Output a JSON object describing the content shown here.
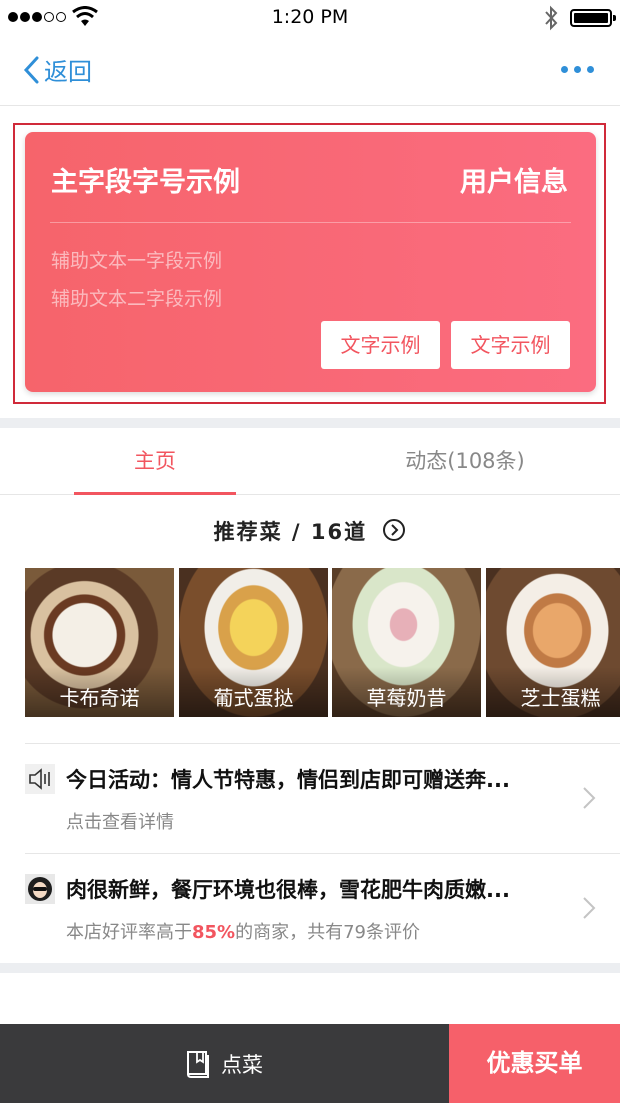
{
  "status_bar": {
    "time": "1:20 PM",
    "icons": [
      "signal-icon",
      "wifi-icon",
      "bluetooth-icon",
      "battery-icon"
    ]
  },
  "nav": {
    "back_label": "返回",
    "back_icon": "chevron-left-icon",
    "more_icon": "more-dots-icon"
  },
  "card": {
    "title": "主字段字号示例",
    "right_label": "用户信息",
    "sub_text_1": "辅助文本一字段示例",
    "sub_text_2": "辅助文本二字段示例",
    "buttons": [
      "文字示例",
      "文字示例"
    ],
    "accent_color": "#f6646b",
    "frame_color": "#d02a3a"
  },
  "tabs": [
    {
      "label": "主页",
      "active": true
    },
    {
      "label": "动态(108条)",
      "active": false
    }
  ],
  "recommended": {
    "title": "推荐菜 / 16道",
    "arrow_icon": "arrow-right-circle-icon",
    "dishes": [
      {
        "name": "卡布奇诺"
      },
      {
        "name": "葡式蛋挞"
      },
      {
        "name": "草莓奶昔"
      },
      {
        "name": "芝士蛋糕"
      }
    ]
  },
  "list": [
    {
      "icon": "speaker-icon",
      "title": "今日活动：情人节特惠，情侣到店即可赠送奔...",
      "subtitle": "点击查看详情"
    },
    {
      "icon": "avatar-icon",
      "title": "肉很新鲜，餐厅环境也很棒，雪花肥牛肉质嫩...",
      "subtitle_prefix": "本店好评率高于",
      "subtitle_highlight": "85%",
      "subtitle_suffix": "的商家，共有79条评价"
    }
  ],
  "bottom_bar": {
    "order_label": "点菜",
    "order_icon": "menu-book-icon",
    "pay_label": "优惠买单",
    "pay_color": "#f6606a"
  }
}
